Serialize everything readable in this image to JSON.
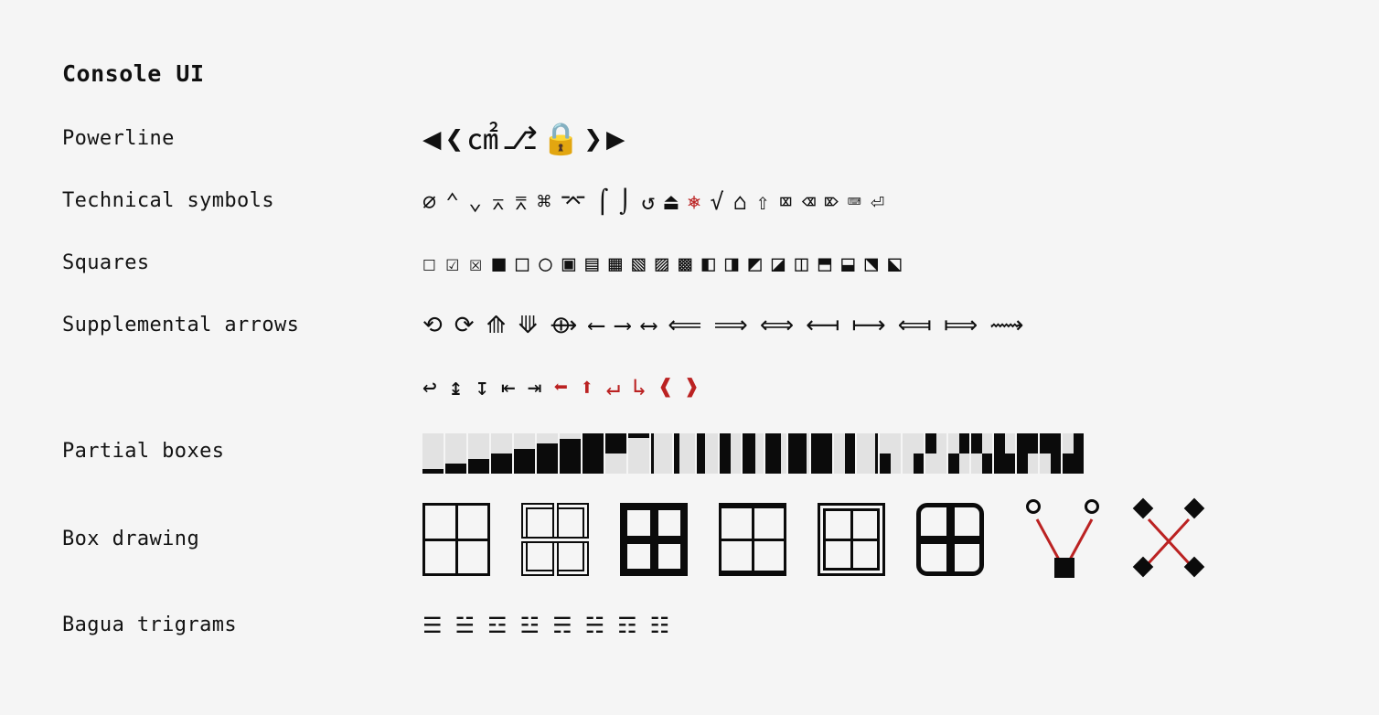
{
  "page": {
    "title": "Console UI",
    "background_color": "#f5f5f5",
    "text_color": "#111111",
    "accent_red": "#bb2222"
  },
  "rows": [
    {
      "label": "Powerline",
      "glyphs": [
        "◀",
        "❮",
        "㎠",
        "⎇",
        "🔒",
        "❯",
        "▶"
      ],
      "icon_names": [
        "left-triangle-icon",
        "left-chevron-icon",
        "ln-branch-icon",
        "git-branch-icon",
        "padlock-icon",
        "right-chevron-icon",
        "right-triangle-icon"
      ]
    },
    {
      "label": "Technical symbols",
      "glyphs": [
        "⌀",
        "⌃",
        "⌄",
        "⌅",
        "⌆",
        "⌘",
        "⌤",
        "⌠",
        "⌡",
        "↺",
        "⏏",
        "⎈",
        "√",
        "⌂",
        "⇧",
        "⌧",
        "⌫",
        "⌦",
        "⌨",
        "⏎"
      ],
      "icon_names": [
        "diameter-icon",
        "up-arrowhead-icon",
        "down-arrowhead-icon",
        "projective-icon",
        "perspective-icon",
        "command-icon",
        "enter-icon",
        "integral-top-icon",
        "integral-bottom-icon",
        "undo-icon",
        "eject-icon",
        "helm-icon",
        "radical-icon",
        "house-icon",
        "shift-icon",
        "clear-icon",
        "backspace-icon",
        "delete-icon",
        "keyboard-icon",
        "return-icon"
      ],
      "red_indices": [
        11
      ]
    },
    {
      "label": "Squares",
      "glyphs": [
        "☐",
        "☑",
        "☒",
        "■",
        "□",
        "○",
        "▣",
        "▤",
        "▦",
        "▧",
        "▨",
        "▩",
        "◧",
        "◨",
        "◩",
        "◪",
        "◫",
        "⬒",
        "⬓",
        "⬔",
        "⬕"
      ],
      "icon_names": [
        "ballot-box-icon",
        "ballot-box-check-icon",
        "ballot-box-x-icon",
        "filled-square-icon",
        "white-square-icon",
        "circle-icon",
        "square-in-square-icon",
        "horizontal-fill-icon",
        "grid-fill-icon",
        "diagonal-fill-icon",
        "reverse-diagonal-fill-icon",
        "dotted-fill-icon",
        "left-half-square-icon",
        "right-half-square-icon",
        "upper-left-triangle-icon",
        "lower-left-triangle-icon",
        "vertical-bisect-icon",
        "quadrant-ul-icon",
        "quadrant-ur-icon",
        "quadrant-ll-icon",
        "quadrant-lr-icon"
      ]
    },
    {
      "label": "Supplemental arrows",
      "glyphs": [
        "⟲",
        "⟳",
        "⟰",
        "⟱",
        "⟴",
        "⟵",
        "⟶",
        "⟷",
        "⟸",
        "⟹",
        "⟺",
        "⟻",
        "⟼",
        "⟽",
        "⟾",
        "⟿"
      ],
      "icon_names": [
        "ccw-open-arrow-icon",
        "cw-open-arrow-icon",
        "triple-up-arrow-icon",
        "triple-down-arrow-icon",
        "circled-plus-arrow-icon",
        "long-left-arrow-icon",
        "long-right-arrow-icon",
        "long-left-right-arrow-icon",
        "long-double-left-arrow-icon",
        "long-double-right-arrow-icon",
        "long-double-left-right-arrow-icon",
        "left-bar-arrow-icon",
        "right-bar-arrow-icon",
        "double-left-bar-arrow-icon",
        "double-right-bar-arrow-icon",
        "squiggle-right-arrow-icon"
      ]
    },
    {
      "label": "",
      "glyphs": [
        "↩",
        "↨",
        "↧",
        "⇤",
        "⇥",
        "⬅",
        "⬆",
        "↵",
        "↳",
        "❰",
        "❱"
      ],
      "icon_names": [
        "hook-left-arrow-icon",
        "up-down-bar-arrow-icon",
        "down-bar-arrow-icon",
        "left-tab-arrow-icon",
        "right-tab-arrow-icon",
        "red-turn-left-arrow-icon",
        "red-turn-right-arrow-icon",
        "red-return-arrow-icon",
        "red-branch-arrow-icon",
        "red-left-angle-bracket-icon",
        "red-right-angle-bracket-icon"
      ],
      "red_indices": [
        5,
        6,
        7,
        8,
        9,
        10
      ]
    },
    {
      "label": "Partial boxes",
      "blocks": [
        {
          "name": "lower-one-eighth-block",
          "fill": "bottom",
          "amount": 12
        },
        {
          "name": "lower-one-quarter-block",
          "fill": "bottom",
          "amount": 25
        },
        {
          "name": "lower-three-eighths-block",
          "fill": "bottom",
          "amount": 37
        },
        {
          "name": "lower-half-block",
          "fill": "bottom",
          "amount": 50
        },
        {
          "name": "lower-five-eighths-block",
          "fill": "bottom",
          "amount": 62
        },
        {
          "name": "lower-three-quarters-block",
          "fill": "bottom",
          "amount": 75
        },
        {
          "name": "lower-seven-eighths-block",
          "fill": "bottom",
          "amount": 87
        },
        {
          "name": "full-block",
          "fill": "bottom",
          "amount": 100
        },
        {
          "name": "upper-half-block",
          "fill": "top",
          "amount": 50
        },
        {
          "name": "upper-one-eighth-block",
          "fill": "top",
          "amount": 12
        },
        {
          "name": "left-one-eighth-block",
          "fill": "left",
          "amount": 12
        },
        {
          "name": "left-one-quarter-block",
          "fill": "left",
          "amount": 25
        },
        {
          "name": "left-three-eighths-block",
          "fill": "left",
          "amount": 37
        },
        {
          "name": "left-half-block",
          "fill": "left",
          "amount": 50
        },
        {
          "name": "left-five-eighths-block",
          "fill": "left",
          "amount": 62
        },
        {
          "name": "left-three-quarters-block",
          "fill": "left",
          "amount": 75
        },
        {
          "name": "left-seven-eighths-block",
          "fill": "left",
          "amount": 87
        },
        {
          "name": "full-block-2",
          "fill": "left",
          "amount": 100
        },
        {
          "name": "right-half-block",
          "fill": "right",
          "amount": 50
        },
        {
          "name": "right-one-eighth-block",
          "fill": "right",
          "amount": 12
        },
        {
          "name": "quadrant-lower-left",
          "fill": "quad",
          "amount": 0,
          "q": [
            0,
            0,
            1,
            0
          ]
        },
        {
          "name": "quadrant-lower-right",
          "fill": "quad",
          "amount": 0,
          "q": [
            0,
            0,
            0,
            1
          ]
        },
        {
          "name": "quadrant-upper-left",
          "fill": "quad",
          "amount": 0,
          "q": [
            1,
            0,
            0,
            0
          ]
        },
        {
          "name": "quadrant-upper-right-lower-left",
          "fill": "quad",
          "amount": 0,
          "q": [
            0,
            1,
            1,
            0
          ]
        },
        {
          "name": "quadrant-upper-left-lower-right",
          "fill": "quad",
          "amount": 0,
          "q": [
            1,
            0,
            0,
            1
          ]
        },
        {
          "name": "quadrant-upper-left-lower-left-lower-right",
          "fill": "quad",
          "amount": 0,
          "q": [
            1,
            0,
            1,
            1
          ]
        },
        {
          "name": "quadrant-upper-left-upper-right-lower-left",
          "fill": "quad",
          "amount": 0,
          "q": [
            1,
            1,
            1,
            0
          ]
        },
        {
          "name": "quadrant-upper-left-upper-right-lower-right",
          "fill": "quad",
          "amount": 0,
          "q": [
            1,
            1,
            0,
            1
          ]
        },
        {
          "name": "quadrant-upper-right-lower-left-lower-right",
          "fill": "quad",
          "amount": 0,
          "q": [
            0,
            1,
            1,
            1
          ]
        }
      ]
    },
    {
      "label": "Box drawing",
      "figures": [
        {
          "name": "box-grid-light",
          "style": "bf-light"
        },
        {
          "name": "box-grid-double",
          "style": "bf-double"
        },
        {
          "name": "box-grid-heavy",
          "style": "bf-heavy"
        },
        {
          "name": "box-grid-mixed",
          "style": "bf-mixed"
        },
        {
          "name": "box-grid-double-outline",
          "style": "bf-dblout"
        },
        {
          "name": "box-grid-rounded-heavy",
          "style": "bf-round"
        }
      ],
      "node_figures": [
        {
          "name": "circles-to-square-diagram"
        },
        {
          "name": "diamonds-cross-diagram"
        }
      ]
    },
    {
      "label": "Bagua trigrams",
      "glyphs": [
        "☰",
        "☱",
        "☲",
        "☳",
        "☴",
        "☵",
        "☶",
        "☷"
      ],
      "icon_names": [
        "trigram-qian-icon",
        "trigram-dui-icon",
        "trigram-li-icon",
        "trigram-zhen-icon",
        "trigram-xun-icon",
        "trigram-kan-icon",
        "trigram-gen-icon",
        "trigram-kun-icon"
      ]
    }
  ]
}
